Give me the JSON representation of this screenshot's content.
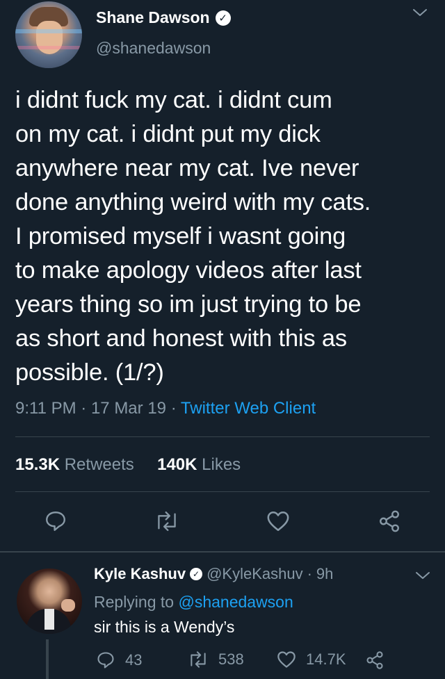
{
  "tweet": {
    "author_name": "Shane Dawson",
    "author_handle": "@shanedawson",
    "text": "i didnt fuck my cat. i didnt cum\non my cat. i didnt put my dick\nanywhere near my cat. Ive never\ndone anything weird with my cats.\nI promised myself i wasnt going\nto make apology videos after last\nyears thing so im just trying to be\nas short and honest with this as\npossible. (1/?)",
    "time": "9:11 PM",
    "date": "17 Mar 19",
    "client": "Twitter Web Client",
    "retweets_count": "15.3K",
    "retweets_label": "Retweets",
    "likes_count": "140K",
    "likes_label": "Likes"
  },
  "reply": {
    "author_name": "Kyle Kashuv",
    "author_handle": "@KyleKashuv",
    "age": "9h",
    "replying_prefix": "Replying to",
    "replying_to": "@shanedawson",
    "text": "sir this is a Wendy’s",
    "reply_count": "43",
    "retweet_count": "538",
    "like_count": "14.7K"
  },
  "colors": {
    "background": "#15202b",
    "secondary_text": "#8899a6",
    "accent": "#1da1f2",
    "divider": "#38444d"
  },
  "icons": [
    "verified-badge-icon",
    "chevron-down-icon",
    "reply-icon",
    "retweet-icon",
    "like-icon",
    "share-icon"
  ]
}
